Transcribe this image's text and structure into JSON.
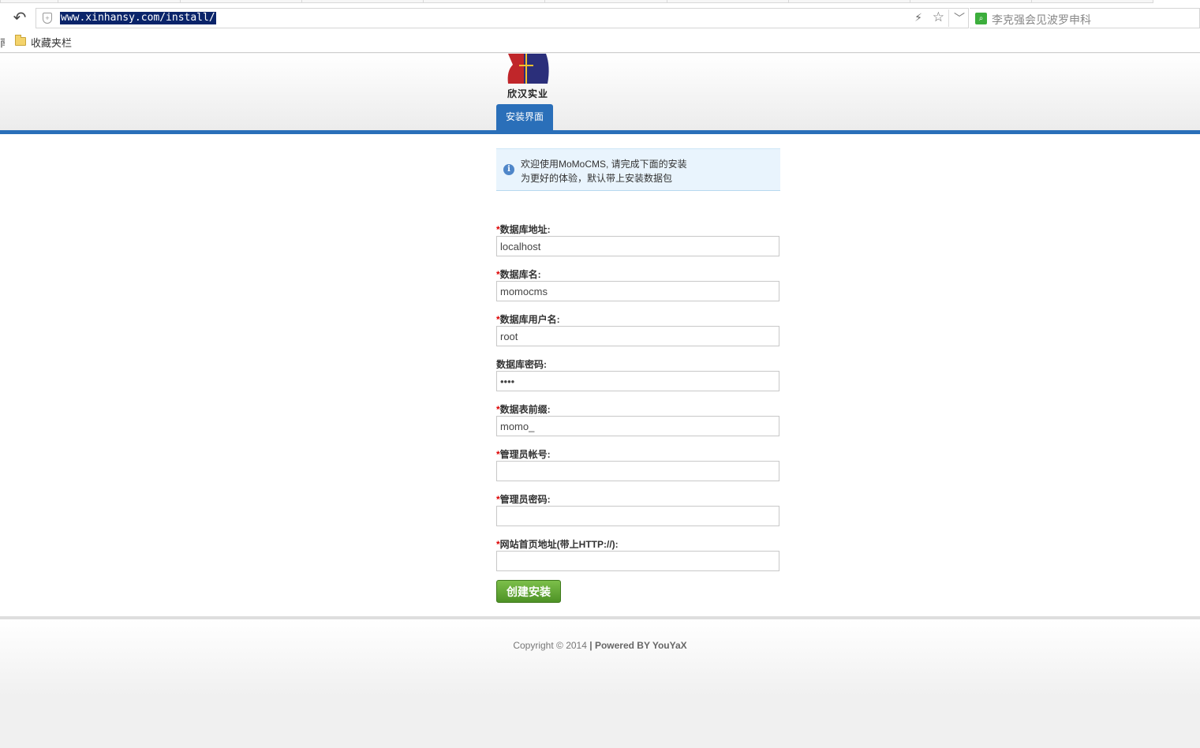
{
  "browser": {
    "url": "www.xinhansy.com/install/",
    "search_text": "李克强会见波罗申科",
    "bookmarks_edge": "南",
    "bookmarks_folder_label": "收藏夹栏"
  },
  "site": {
    "logo_text": "欣汉实业",
    "nav_tab": "安装界面"
  },
  "notice": {
    "line1": "欢迎使用MoMoCMS, 请完成下面的安装",
    "line2": "为更好的体验，默认带上安装数据包"
  },
  "form": {
    "fields": [
      {
        "label": "数据库地址:",
        "required": true,
        "value": "localhost"
      },
      {
        "label": "数据库名:",
        "required": true,
        "value": "momocms"
      },
      {
        "label": "数据库用户名:",
        "required": true,
        "value": "root"
      },
      {
        "label": "数据库密码:",
        "required": false,
        "value": "root"
      },
      {
        "label": "数据表前缀:",
        "required": true,
        "value": "momo_"
      },
      {
        "label": "管理员帐号:",
        "required": true,
        "value": ""
      },
      {
        "label": "管理员密码:",
        "required": true,
        "value": ""
      },
      {
        "label": "网站首页地址(带上HTTP://):",
        "required": true,
        "value": ""
      }
    ],
    "required_mark": "*",
    "submit_label": "创建安装"
  },
  "footer": {
    "copyright": "Copyright © 2014",
    "separator": "|",
    "powered": "Powered BY YouYaX"
  }
}
